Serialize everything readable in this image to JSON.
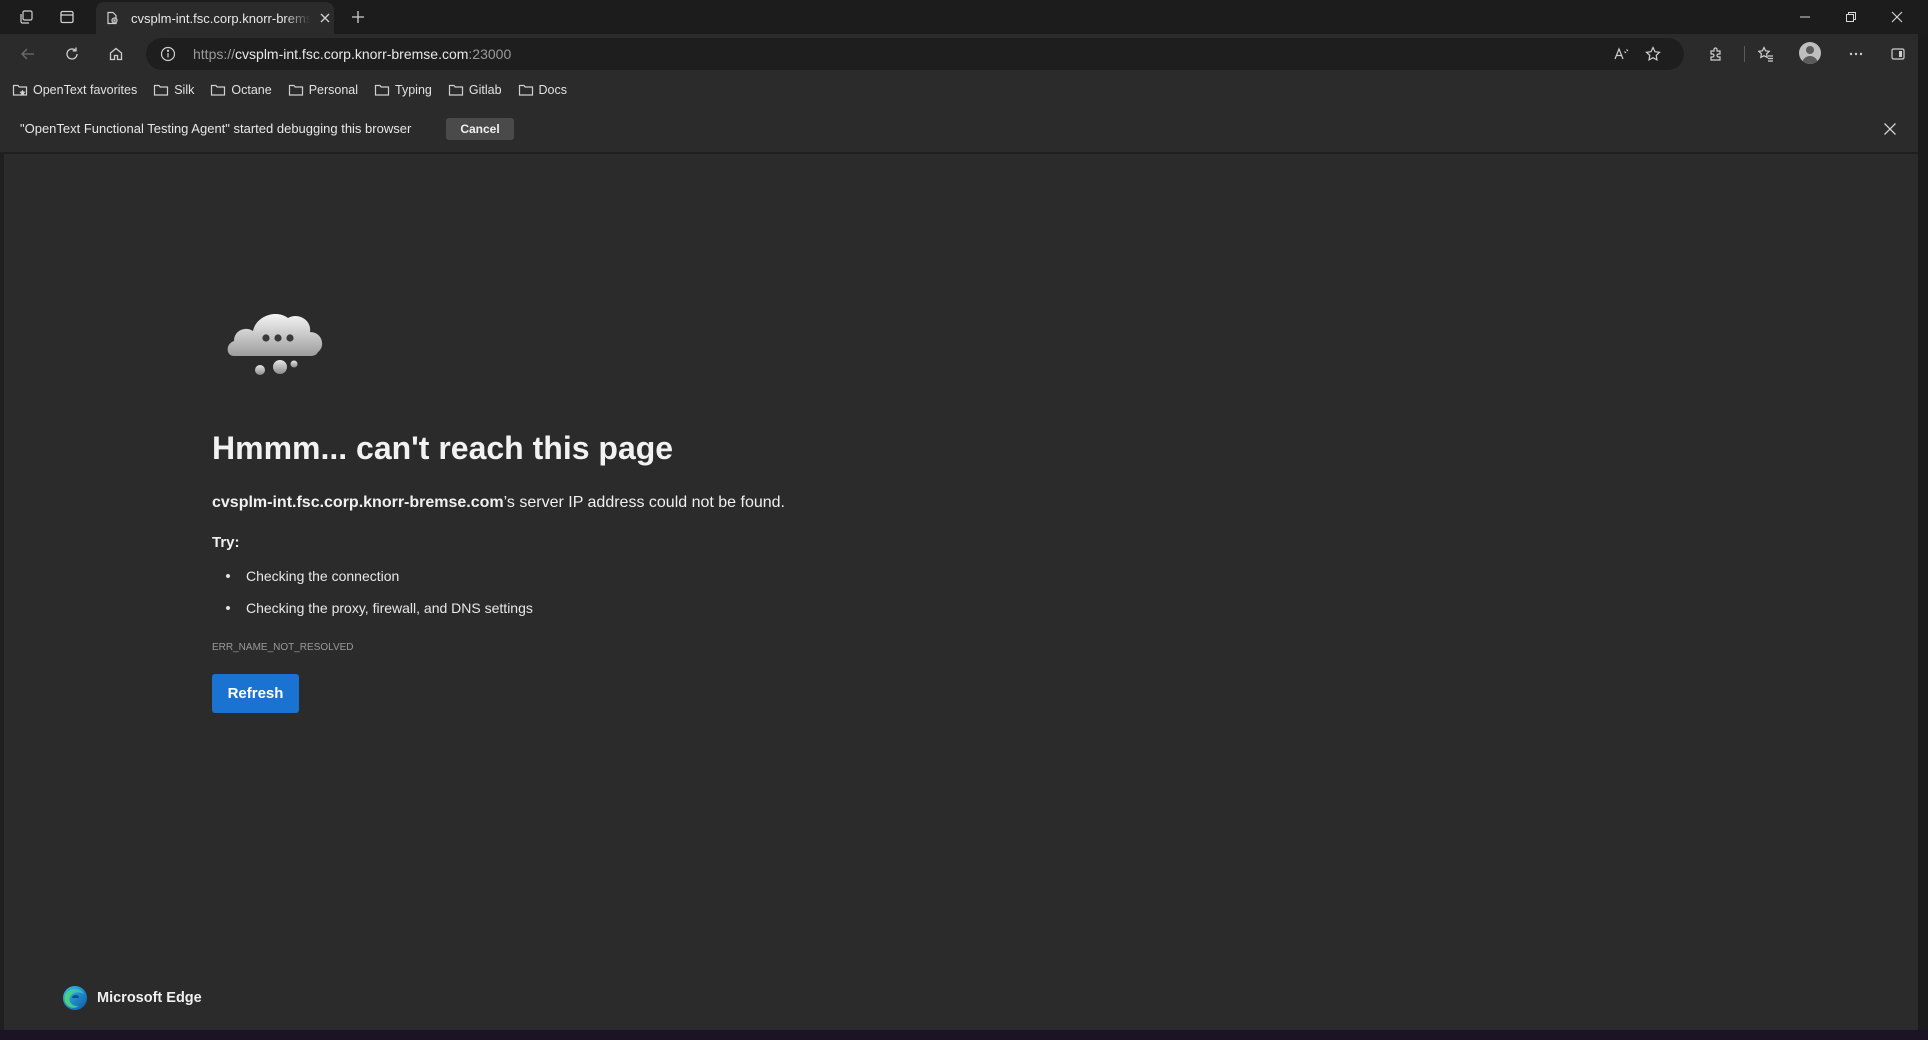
{
  "tab": {
    "title": "cvsplm-int.fsc.corp.knorr-bremse.com"
  },
  "address_bar": {
    "protocol": "https://",
    "host": "cvsplm-int.fsc.corp.knorr-bremse.com",
    "port": ":23000"
  },
  "favorites": [
    {
      "label": "OpenText favorites",
      "icon": "favorites-folder-icon"
    },
    {
      "label": "Silk",
      "icon": "folder-icon"
    },
    {
      "label": "Octane",
      "icon": "folder-icon"
    },
    {
      "label": "Personal",
      "icon": "folder-icon"
    },
    {
      "label": "Typing",
      "icon": "folder-icon"
    },
    {
      "label": "Gitlab",
      "icon": "folder-icon"
    },
    {
      "label": "Docs",
      "icon": "folder-icon"
    }
  ],
  "infobar": {
    "message": "\"OpenText Functional Testing Agent\" started debugging this browser",
    "cancel_label": "Cancel"
  },
  "error_page": {
    "title": "Hmmm... can't reach this page",
    "host": "cvsplm-int.fsc.corp.knorr-bremse.com",
    "description_suffix": "’s server IP address could not be found.",
    "try_label": "Try:",
    "suggestions": [
      "Checking the connection",
      "Checking the proxy, firewall, and DNS settings"
    ],
    "error_code": "ERR_NAME_NOT_RESOLVED",
    "refresh_label": "Refresh",
    "brand": "Microsoft Edge"
  },
  "colors": {
    "accent": "#1a73d0",
    "page_background": "#2b2b2b",
    "frame_background": "#1c1c1c"
  }
}
